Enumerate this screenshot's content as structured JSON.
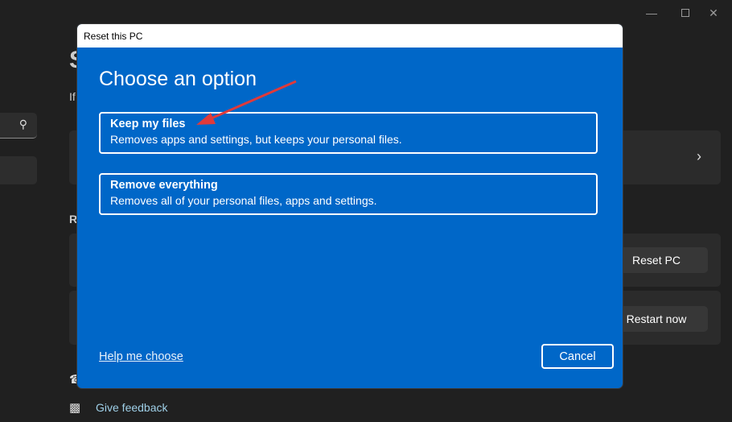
{
  "window": {
    "minimize_icon": "minimize-icon",
    "maximize_icon": "maximize-icon",
    "close_icon": "close-icon"
  },
  "background": {
    "heading_fragment": "S",
    "subtitle_fragment": "If",
    "section_fragment": "R",
    "reset_pc_label": "Reset PC",
    "restart_now_label": "Restart now",
    "give_feedback_label": "Give feedback"
  },
  "dialog": {
    "title": "Reset this PC",
    "heading": "Choose an option",
    "options": [
      {
        "title": "Keep my files",
        "description": "Removes apps and settings, but keeps your personal files."
      },
      {
        "title": "Remove everything",
        "description": "Removes all of your personal files, apps and settings."
      }
    ],
    "help_link": "Help me choose",
    "cancel_label": "Cancel",
    "accent_color": "#0067c8",
    "annotation_arrow_color": "#e03a3a"
  }
}
